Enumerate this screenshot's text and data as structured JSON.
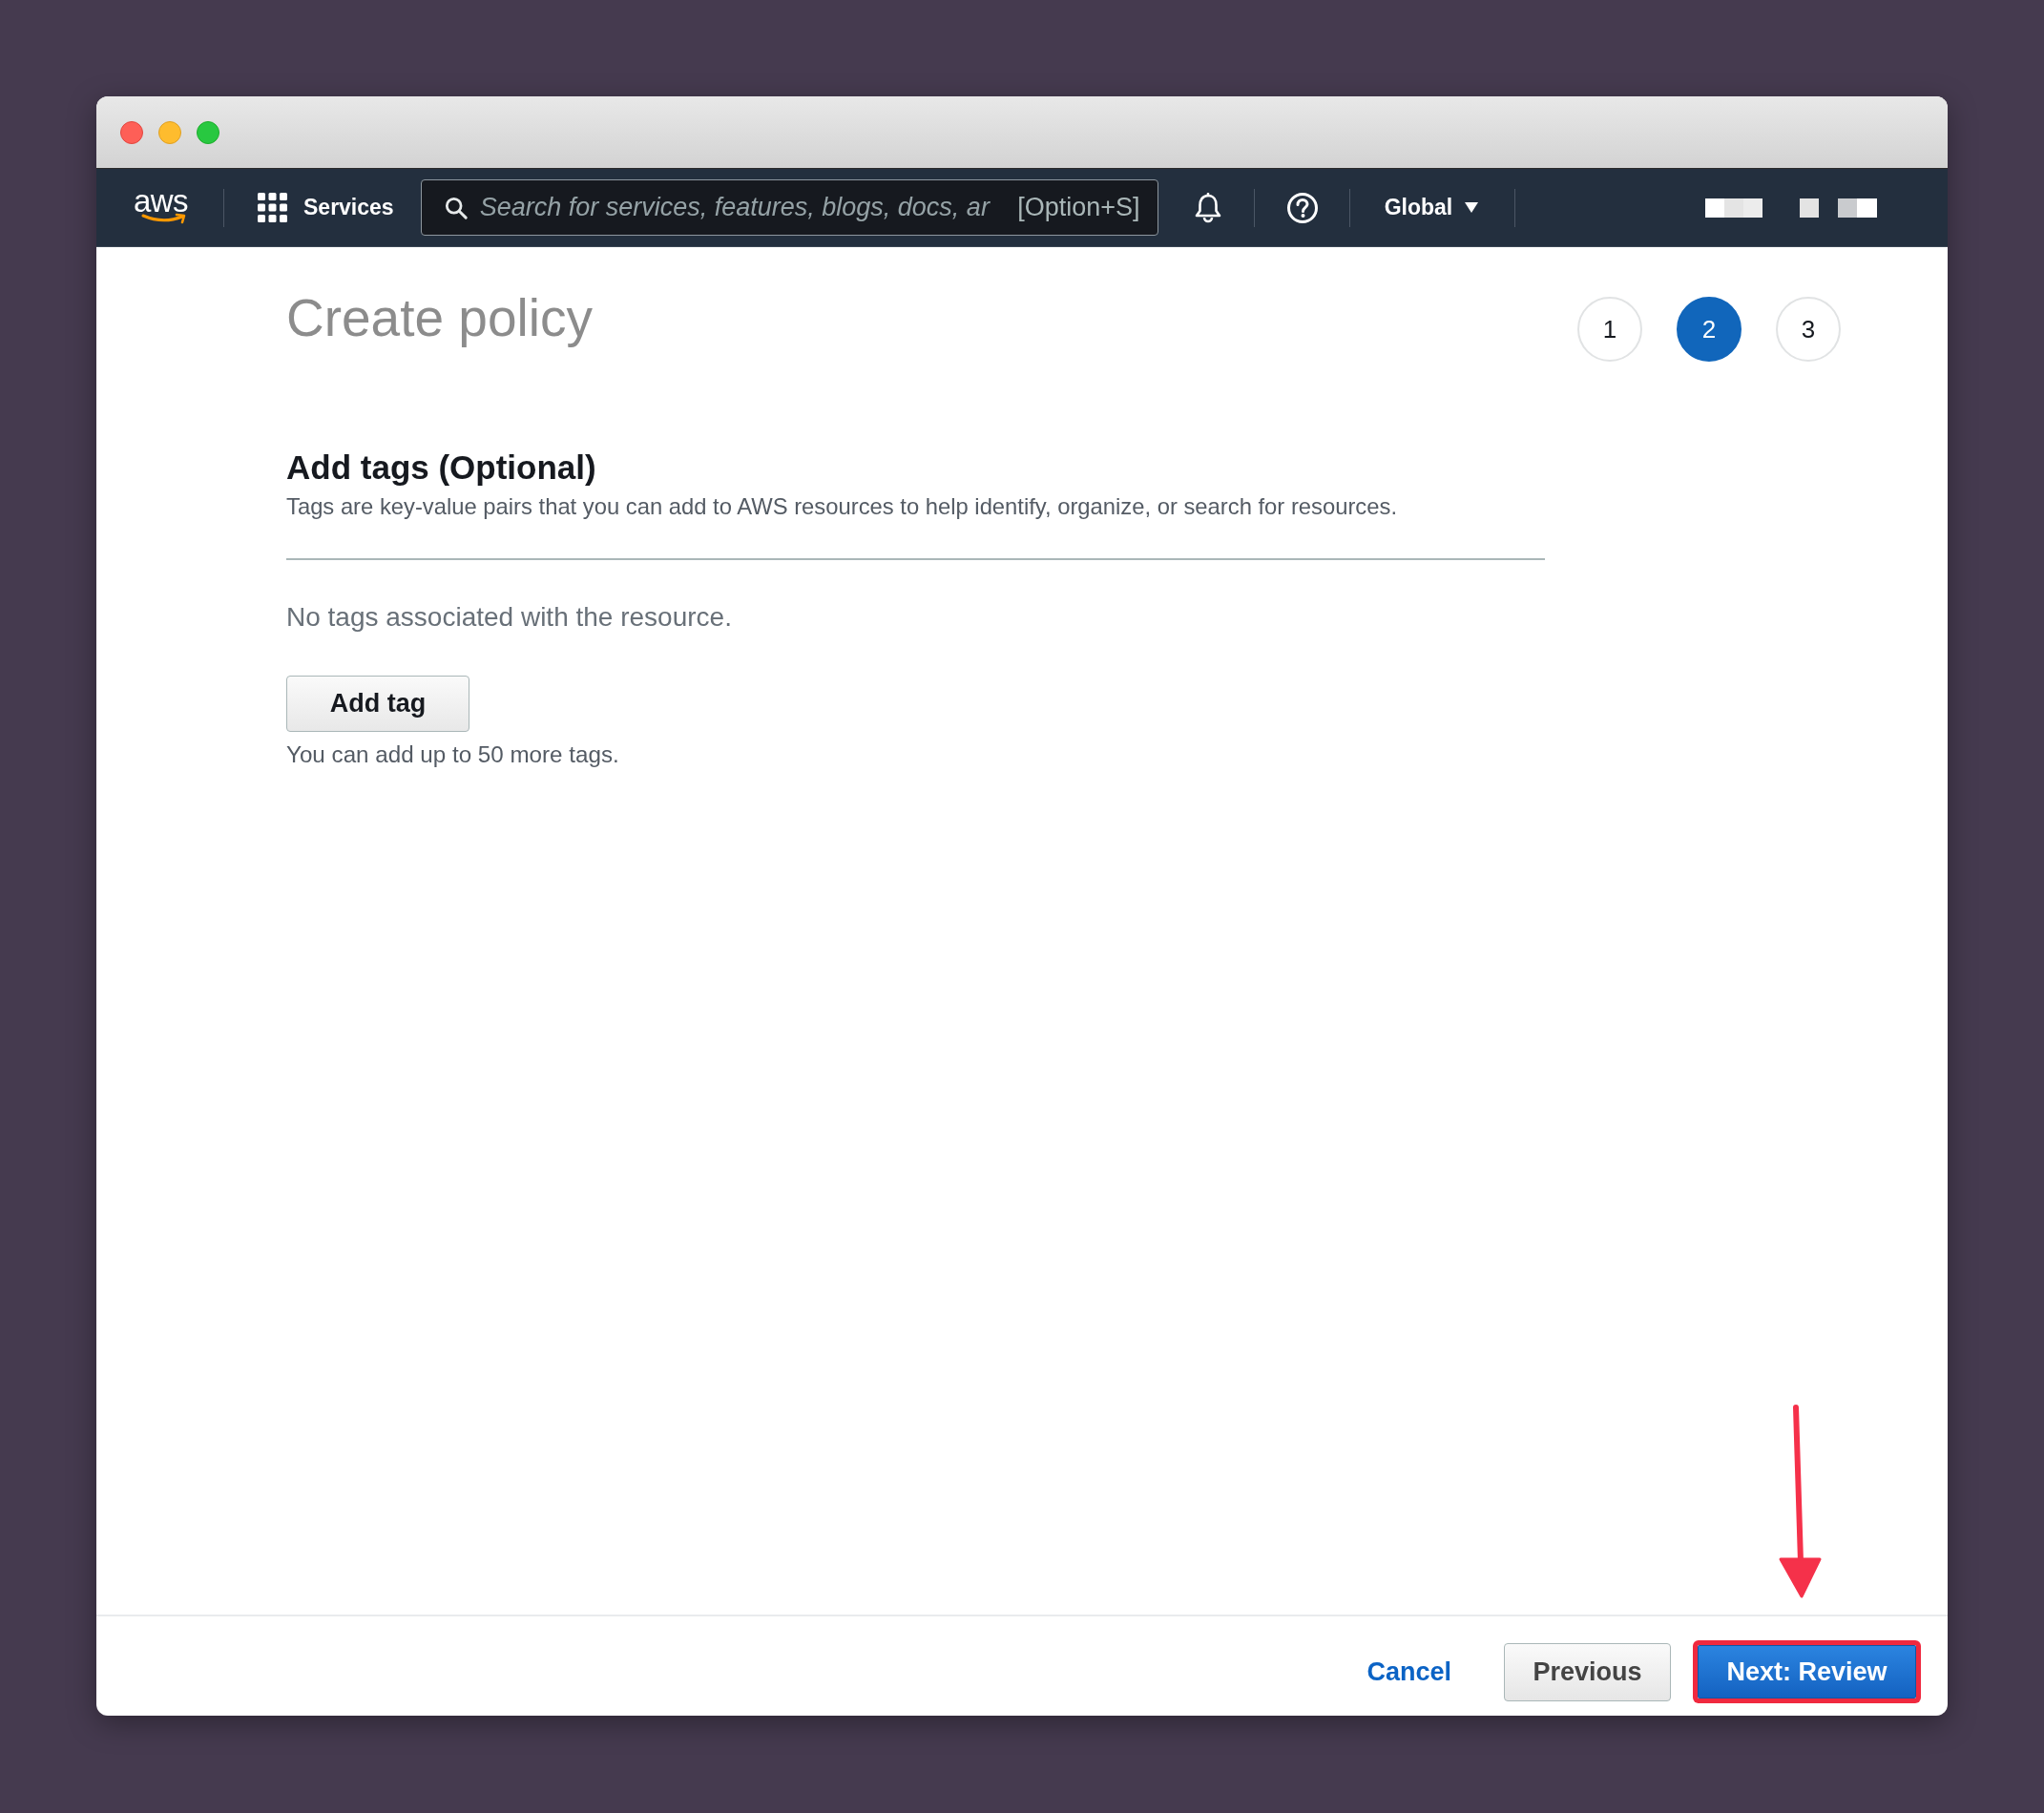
{
  "nav": {
    "logo": "aws",
    "services": "Services",
    "search": {
      "placeholder": "Search for services, features, blogs, docs, ar",
      "shortcut": "[Option+S]"
    },
    "region": "Global"
  },
  "page": {
    "title": "Create policy"
  },
  "steps": [
    {
      "label": "1",
      "selected": false
    },
    {
      "label": "2",
      "selected": true
    },
    {
      "label": "3",
      "selected": false
    }
  ],
  "section": {
    "heading": "Add tags (Optional)",
    "description": "Tags are key-value pairs that you can add to AWS resources to help identify, organize, or search for resources.",
    "empty_message": "No tags associated with the resource.",
    "add_button": "Add tag",
    "limit_note": "You can add up to 50 more tags."
  },
  "footer": {
    "buttons": [
      {
        "label": "Cancel",
        "kind": "link",
        "highlighted": false
      },
      {
        "label": "Previous",
        "kind": "secondary",
        "highlighted": false
      },
      {
        "label": "Next: Review",
        "kind": "primary",
        "highlighted": true
      }
    ]
  }
}
